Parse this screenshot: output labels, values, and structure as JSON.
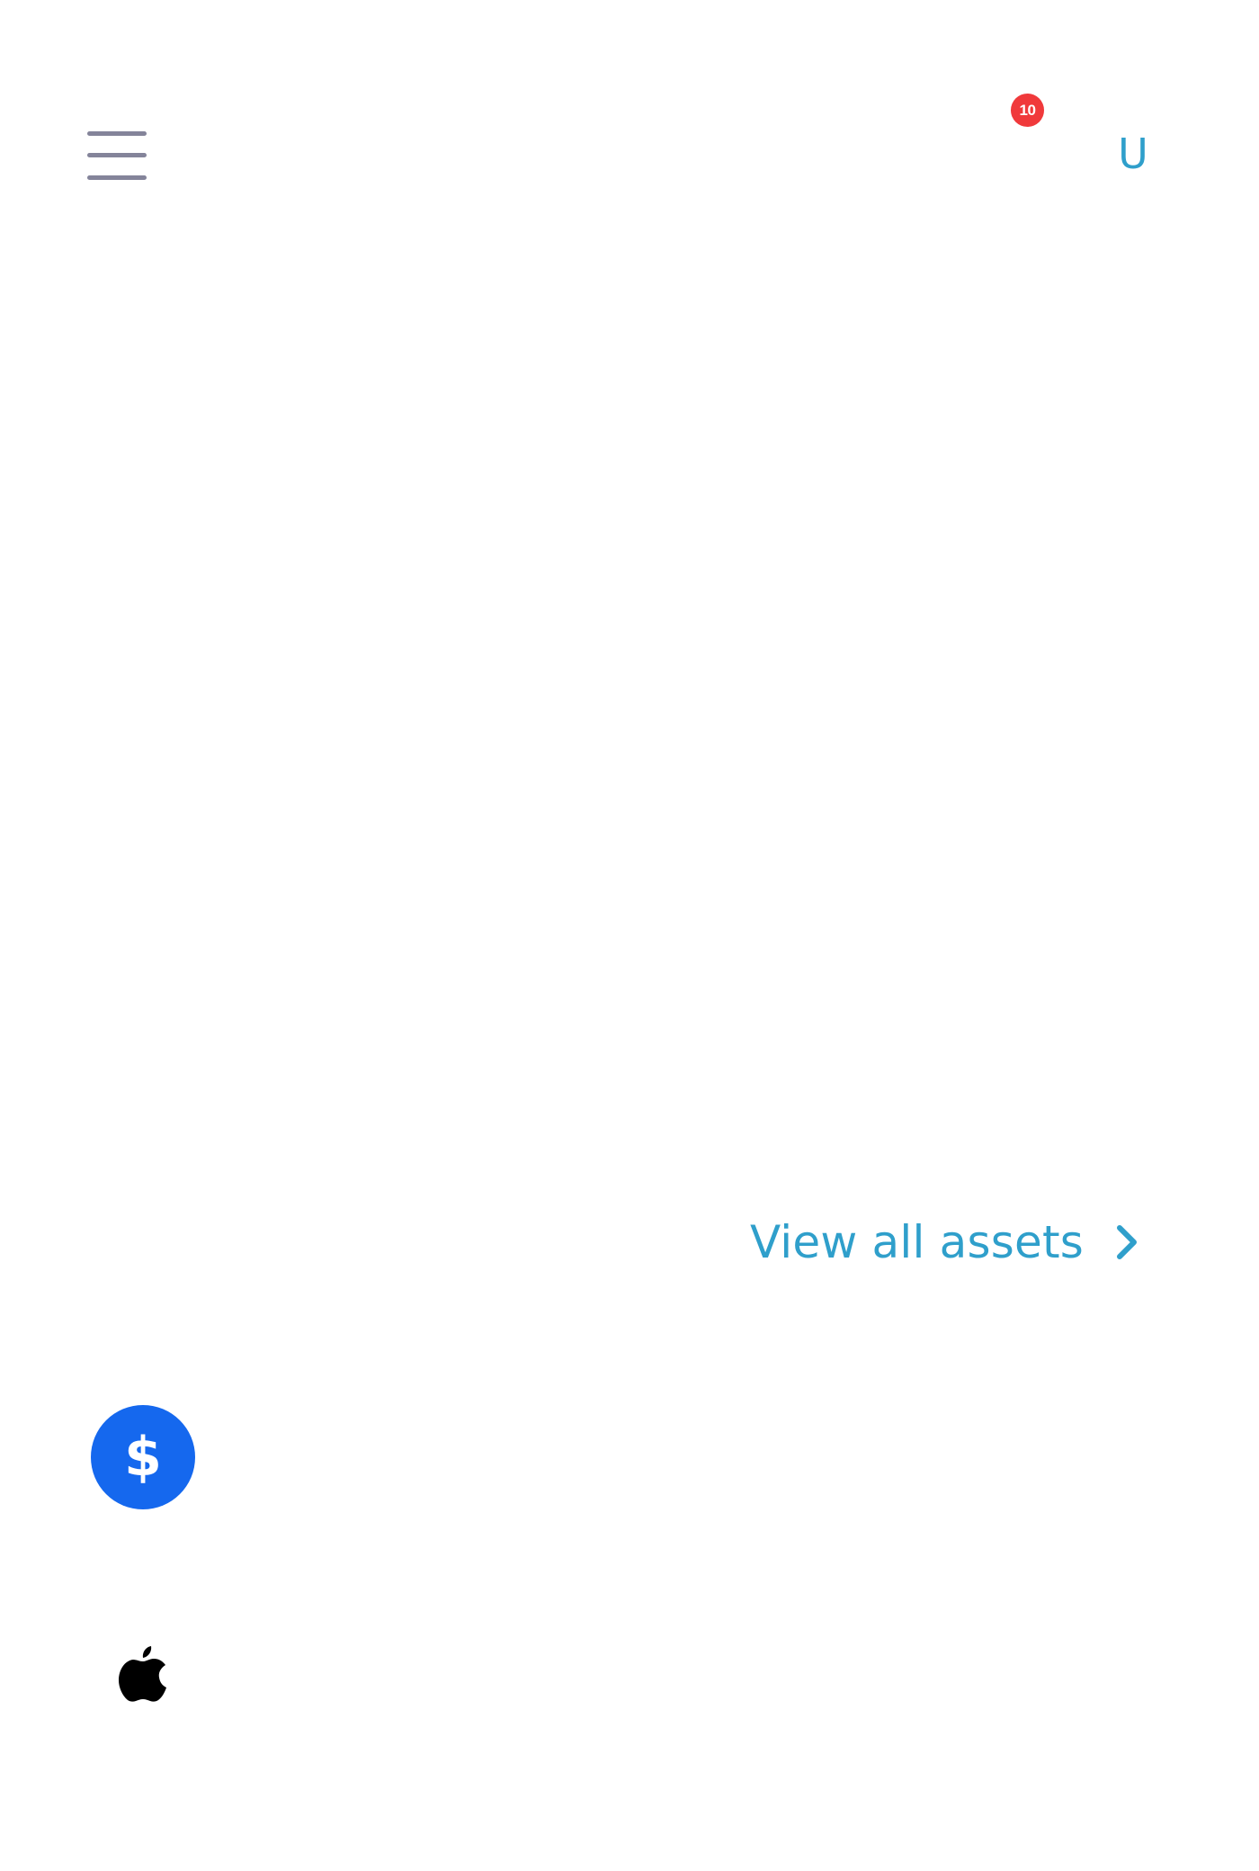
{
  "header": {
    "notification_count": "10",
    "avatar_initial": "U"
  },
  "assets_section": {
    "view_all_label": "View all assets"
  },
  "assets": [
    {
      "icon": "dollar-icon",
      "glyph": "$",
      "color": "#1568ee"
    },
    {
      "icon": "apple-logo-icon",
      "color": "#000000"
    }
  ],
  "colors": {
    "accent": "#2f9fcb",
    "badge": "#f0393b",
    "menu_icon": "#84849a",
    "usd_circle": "#1568ee"
  }
}
